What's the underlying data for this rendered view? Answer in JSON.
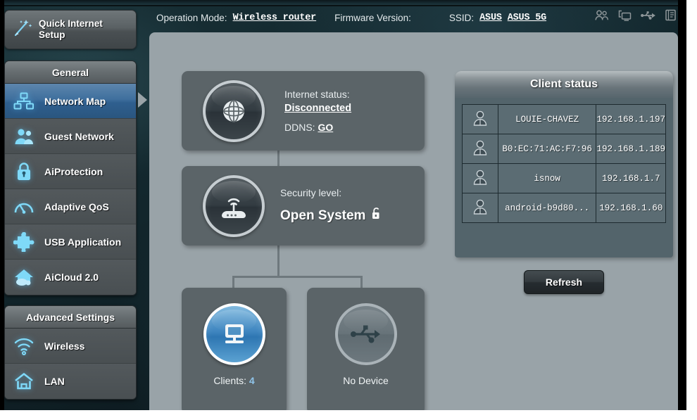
{
  "header": {
    "operation_mode_label": "Operation Mode:",
    "operation_mode_value": "Wireless router",
    "firmware_label": "Firmware Version:",
    "firmware_value": "",
    "ssid_label": "SSID:",
    "ssid_value_1": "ASUS",
    "ssid_value_2": "ASUS_5G",
    "icons": [
      "guest-users-icon",
      "network-clients-icon",
      "usb-icon",
      "system-log-icon"
    ]
  },
  "sidebar": {
    "quick_setup_label": "Quick Internet Setup",
    "quick_setup_icon": "magic-wand-icon",
    "groups": [
      {
        "title": "General",
        "items": [
          {
            "label": "Network Map",
            "icon": "network-map-icon",
            "active": true
          },
          {
            "label": "Guest Network",
            "icon": "guest-network-icon",
            "active": false
          },
          {
            "label": "AiProtection",
            "icon": "lock-shield-icon",
            "active": false
          },
          {
            "label": "Adaptive QoS",
            "icon": "speedometer-icon",
            "active": false
          },
          {
            "label": "USB Application",
            "icon": "puzzle-piece-icon",
            "active": false
          },
          {
            "label": "AiCloud 2.0",
            "icon": "cloud-house-icon",
            "active": false
          }
        ]
      },
      {
        "title": "Advanced Settings",
        "items": [
          {
            "label": "Wireless",
            "icon": "wifi-icon",
            "active": false
          },
          {
            "label": "LAN",
            "icon": "house-icon",
            "active": false
          }
        ]
      }
    ]
  },
  "network_map": {
    "internet": {
      "icon": "globe-icon",
      "status_label": "Internet status:",
      "status_value": "Disconnected",
      "ddns_label": "DDNS:",
      "ddns_action": "GO"
    },
    "security": {
      "icon": "router-signal-icon",
      "label": "Security level:",
      "value": "Open System",
      "lock_icon": "unlocked-padlock-icon"
    },
    "clients": {
      "icon": "monitor-icon",
      "caption_label": "Clients:",
      "caption_value": "4"
    },
    "usb": {
      "icon": "usb-icon",
      "caption": "No Device"
    }
  },
  "client_status": {
    "title": "Client status",
    "rows": [
      {
        "icon": "user-icon",
        "name": "LOUIE-CHAVEZ",
        "ip": "192.168.1.197"
      },
      {
        "icon": "user-icon",
        "name": "B0:EC:71:AC:F7:96",
        "ip": "192.168.1.189"
      },
      {
        "icon": "user-icon",
        "name": "isnow",
        "ip": "192.168.1.7"
      },
      {
        "icon": "user-icon",
        "name": "android-b9d80...",
        "ip": "192.168.1.60"
      }
    ],
    "refresh_label": "Refresh"
  },
  "colors": {
    "accent_blue": "#3f86c0",
    "selected_item": "#3f6f9d",
    "panel_grey": "#99a3a8",
    "card_grey": "#5b6468",
    "table_slate": "#5b6c73"
  }
}
